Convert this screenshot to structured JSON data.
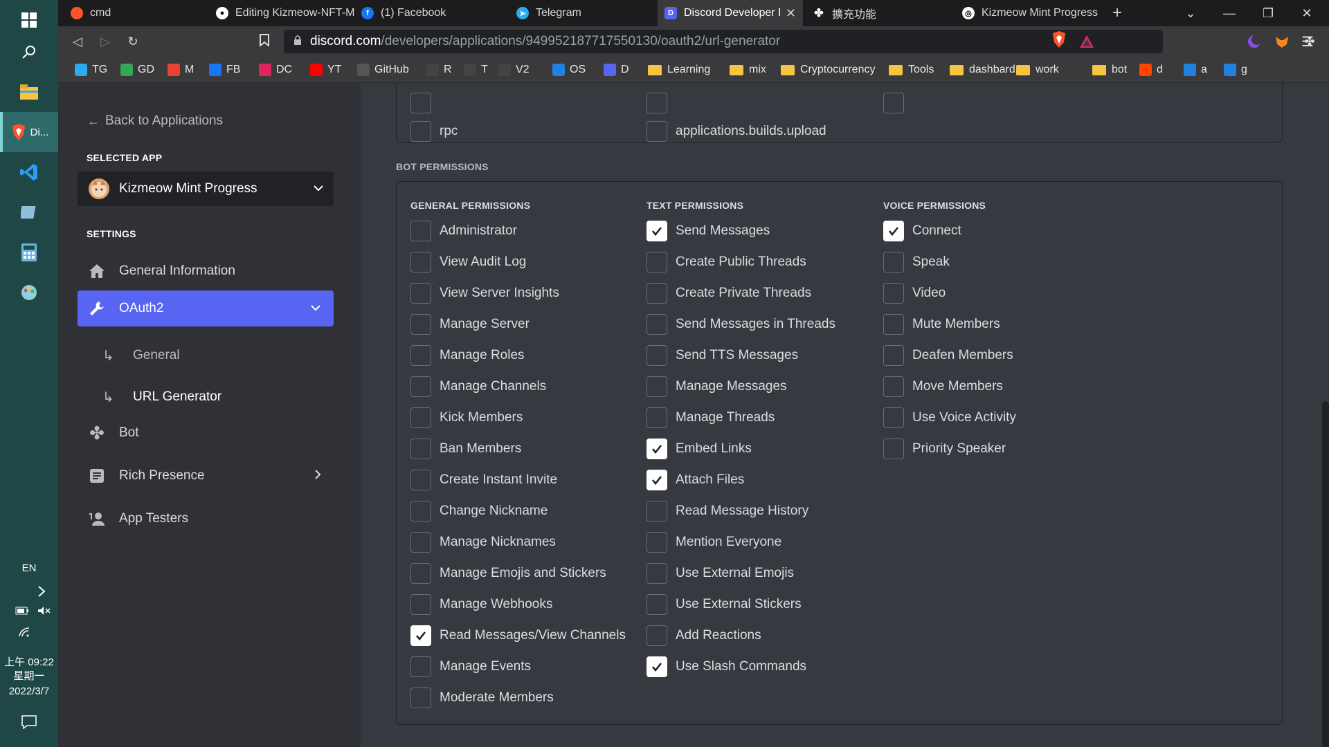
{
  "taskbar": {
    "active_app_label": "Di...",
    "language": "EN",
    "time": "上午 09:22",
    "weekday": "星期一",
    "date": "2022/3/7"
  },
  "tabs": [
    {
      "title": "cmd",
      "icon": "brave-icon"
    },
    {
      "title": "Editing Kizmeow-NFT-M",
      "icon": "github-icon"
    },
    {
      "title": "(1) Facebook",
      "icon": "facebook-icon"
    },
    {
      "title": "Telegram",
      "icon": "telegram-icon"
    },
    {
      "title": "Discord Developer P",
      "icon": "discord-icon"
    },
    {
      "title": "擴充功能",
      "icon": "puzzle-icon"
    },
    {
      "title": "Kizmeow Mint Progress",
      "icon": "app-icon"
    }
  ],
  "address_bar": {
    "host": "discord.com",
    "path": "/developers/applications/949952187717550130/oauth2/url-generator"
  },
  "bookmarks": [
    {
      "label": "TG",
      "type": "site",
      "color": "#2aabee"
    },
    {
      "label": "GD",
      "type": "site",
      "color": "#34a853"
    },
    {
      "label": "M",
      "type": "site",
      "color": "#ea4335"
    },
    {
      "label": "FB",
      "type": "site",
      "color": "#1877f2"
    },
    {
      "label": "DC",
      "type": "site",
      "color": "#e0245e"
    },
    {
      "label": "YT",
      "type": "site",
      "color": "#ff0000"
    },
    {
      "label": "GitHub",
      "type": "site",
      "color": "#555555"
    },
    {
      "label": "R",
      "type": "site",
      "color": "#444444"
    },
    {
      "label": "T",
      "type": "site",
      "color": "#444444"
    },
    {
      "label": "V2",
      "type": "site",
      "color": "#444444"
    },
    {
      "label": "OS",
      "type": "site",
      "color": "#2081e2"
    },
    {
      "label": "D",
      "type": "site",
      "color": "#5865f2"
    },
    {
      "label": "Learning",
      "type": "folder"
    },
    {
      "label": "mix",
      "type": "folder"
    },
    {
      "label": "Cryptocurrency",
      "type": "folder"
    },
    {
      "label": "Tools",
      "type": "folder"
    },
    {
      "label": "dashbard",
      "type": "folder"
    },
    {
      "label": "work",
      "type": "folder"
    },
    {
      "label": "bot",
      "type": "folder"
    },
    {
      "label": "d",
      "type": "site",
      "color": "#ff4500"
    },
    {
      "label": "a",
      "type": "site",
      "color": "#2081e2"
    },
    {
      "label": "g",
      "type": "site",
      "color": "#2081e2"
    }
  ],
  "sidebar": {
    "back_label": "Back to Applications",
    "selected_app_heading": "SELECTED APP",
    "app_name": "Kizmeow Mint Progress",
    "settings_heading": "SETTINGS",
    "items": [
      {
        "label": "General Information",
        "icon": "home-icon"
      },
      {
        "label": "OAuth2",
        "icon": "wrench-icon"
      },
      {
        "label": "Bot",
        "icon": "puzzle-icon"
      },
      {
        "label": "Rich Presence",
        "icon": "document-icon"
      },
      {
        "label": "App Testers",
        "icon": "person-icon"
      }
    ],
    "sub_items": [
      {
        "label": "General"
      },
      {
        "label": "URL Generator"
      }
    ]
  },
  "scopes_partial": [
    {
      "label": "rpc",
      "checked": false
    },
    {
      "label": "applications.builds.upload",
      "checked": false
    }
  ],
  "bot_permissions": {
    "title": "BOT PERMISSIONS",
    "general": {
      "title": "GENERAL PERMISSIONS",
      "items": [
        {
          "label": "Administrator",
          "checked": false
        },
        {
          "label": "View Audit Log",
          "checked": false
        },
        {
          "label": "View Server Insights",
          "checked": false
        },
        {
          "label": "Manage Server",
          "checked": false
        },
        {
          "label": "Manage Roles",
          "checked": false
        },
        {
          "label": "Manage Channels",
          "checked": false
        },
        {
          "label": "Kick Members",
          "checked": false
        },
        {
          "label": "Ban Members",
          "checked": false
        },
        {
          "label": "Create Instant Invite",
          "checked": false
        },
        {
          "label": "Change Nickname",
          "checked": false
        },
        {
          "label": "Manage Nicknames",
          "checked": false
        },
        {
          "label": "Manage Emojis and Stickers",
          "checked": false
        },
        {
          "label": "Manage Webhooks",
          "checked": false
        },
        {
          "label": "Read Messages/View Channels",
          "checked": true
        },
        {
          "label": "Manage Events",
          "checked": false
        },
        {
          "label": "Moderate Members",
          "checked": false
        }
      ]
    },
    "text": {
      "title": "TEXT PERMISSIONS",
      "items": [
        {
          "label": "Send Messages",
          "checked": true
        },
        {
          "label": "Create Public Threads",
          "checked": false
        },
        {
          "label": "Create Private Threads",
          "checked": false
        },
        {
          "label": "Send Messages in Threads",
          "checked": false
        },
        {
          "label": "Send TTS Messages",
          "checked": false
        },
        {
          "label": "Manage Messages",
          "checked": false
        },
        {
          "label": "Manage Threads",
          "checked": false
        },
        {
          "label": "Embed Links",
          "checked": true
        },
        {
          "label": "Attach Files",
          "checked": true
        },
        {
          "label": "Read Message History",
          "checked": false
        },
        {
          "label": "Mention Everyone",
          "checked": false
        },
        {
          "label": "Use External Emojis",
          "checked": false
        },
        {
          "label": "Use External Stickers",
          "checked": false
        },
        {
          "label": "Add Reactions",
          "checked": false
        },
        {
          "label": "Use Slash Commands",
          "checked": true
        }
      ]
    },
    "voice": {
      "title": "VOICE PERMISSIONS",
      "items": [
        {
          "label": "Connect",
          "checked": true
        },
        {
          "label": "Speak",
          "checked": false
        },
        {
          "label": "Video",
          "checked": false
        },
        {
          "label": "Mute Members",
          "checked": false
        },
        {
          "label": "Deafen Members",
          "checked": false
        },
        {
          "label": "Move Members",
          "checked": false
        },
        {
          "label": "Use Voice Activity",
          "checked": false
        },
        {
          "label": "Priority Speaker",
          "checked": false
        }
      ]
    }
  },
  "colors": {
    "accent": "#5865f2",
    "sidebar_bg": "#2f3136",
    "content_bg": "#36393f",
    "taskbar_bg": "#1e4746"
  }
}
